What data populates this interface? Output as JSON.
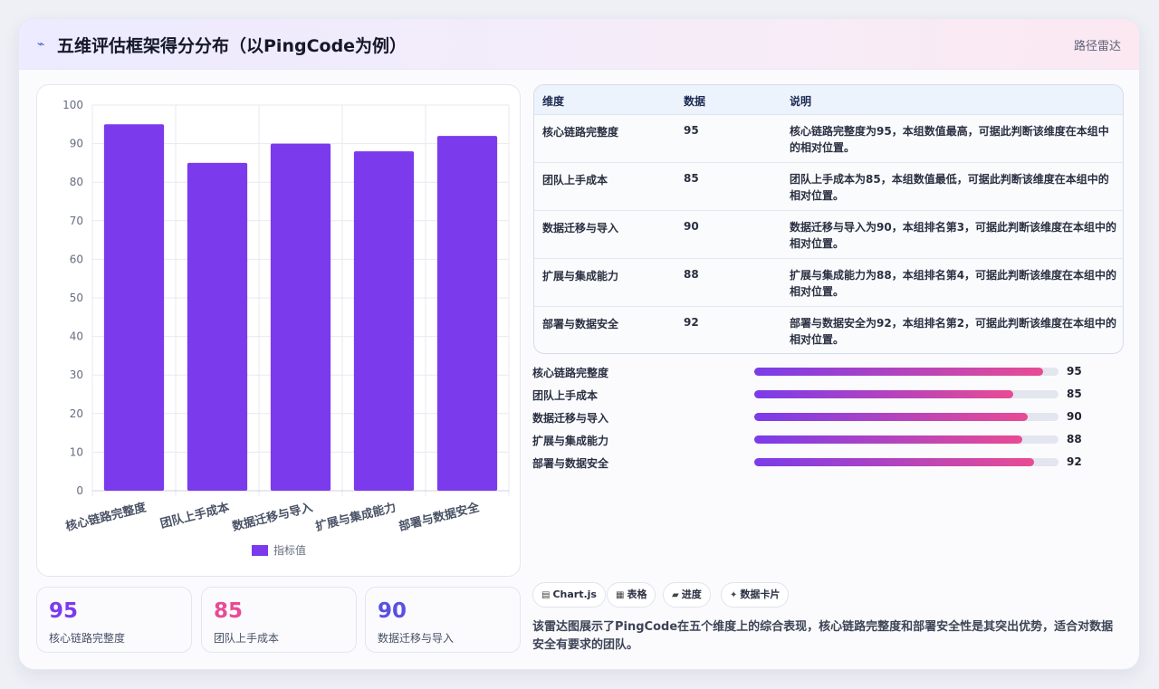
{
  "header": {
    "title": "五维评估框架得分分布（以PingCode为例）",
    "tag": "路径雷达",
    "icon": "line-chart-icon"
  },
  "chart_data": {
    "type": "bar",
    "categories": [
      "核心链路完整度",
      "团队上手成本",
      "数据迁移与导入",
      "扩展与集成能力",
      "部署与数据安全"
    ],
    "series": [
      {
        "name": "指标值",
        "values": [
          95,
          85,
          90,
          88,
          92
        ],
        "color": "#7c3aed"
      }
    ],
    "ylim": [
      0,
      100
    ],
    "yticks": [
      0,
      10,
      20,
      30,
      40,
      50,
      60,
      70,
      80,
      90,
      100
    ],
    "legend": "bottom",
    "grid": true
  },
  "stats": [
    {
      "value": "95",
      "label": "核心链路完整度",
      "color": "#7c3aed"
    },
    {
      "value": "85",
      "label": "团队上手成本",
      "color": "#e84b94"
    },
    {
      "value": "90",
      "label": "数据迁移与导入",
      "color": "#5b50e0"
    }
  ],
  "table": {
    "headers": [
      "维度",
      "数据",
      "说明"
    ],
    "rows": [
      {
        "dim": "核心链路完整度",
        "val": "95",
        "desc": "核心链路完整度为95，本组数值最高，可据此判断该维度在本组中的相对位置。"
      },
      {
        "dim": "团队上手成本",
        "val": "85",
        "desc": "团队上手成本为85，本组数值最低，可据此判断该维度在本组中的相对位置。"
      },
      {
        "dim": "数据迁移与导入",
        "val": "90",
        "desc": "数据迁移与导入为90，本组排名第3，可据此判断该维度在本组中的相对位置。"
      },
      {
        "dim": "扩展与集成能力",
        "val": "88",
        "desc": "扩展与集成能力为88，本组排名第4，可据此判断该维度在本组中的相对位置。"
      },
      {
        "dim": "部署与数据安全",
        "val": "92",
        "desc": "部署与数据安全为92，本组排名第2，可据此判断该维度在本组中的相对位置。"
      }
    ]
  },
  "progress": [
    {
      "label": "核心链路完整度",
      "value": "95",
      "percent": 95
    },
    {
      "label": "团队上手成本",
      "value": "85",
      "percent": 85
    },
    {
      "label": "数据迁移与导入",
      "value": "90",
      "percent": 90
    },
    {
      "label": "扩展与集成能力",
      "value": "88",
      "percent": 88
    },
    {
      "label": "部署与数据安全",
      "value": "92",
      "percent": 92
    }
  ],
  "pills": [
    {
      "icon": "chart-icon",
      "glyph": "▤",
      "label": "Chart.js"
    },
    {
      "icon": "table-icon",
      "glyph": "▦",
      "label": "表格"
    },
    {
      "icon": "progress-icon",
      "glyph": "▰",
      "label": "进度"
    },
    {
      "icon": "sparkle-icon",
      "glyph": "✦",
      "label": "数据卡片"
    }
  ],
  "summary": "该雷达图展示了PingCode在五个维度上的综合表现，核心链路完整度和部署安全性是其突出优势，适合对数据安全有要求的团队。"
}
